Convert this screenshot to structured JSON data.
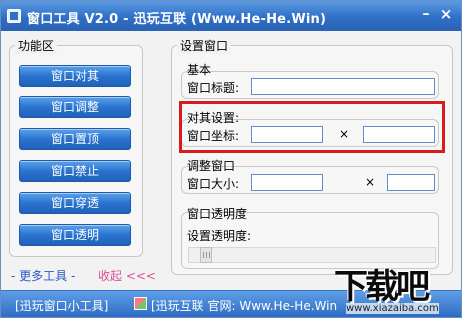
{
  "window": {
    "title": "窗口工具 V2.0 - 迅玩互联 (Www.He-He.Win)",
    "minimize_glyph": "–",
    "close_glyph": "×"
  },
  "left_panel": {
    "label": "功能区",
    "buttons": [
      "窗口对其",
      "窗口调整",
      "窗口置顶",
      "窗口禁止",
      "窗口穿透",
      "窗口透明"
    ],
    "more_link": "- 更多工具 -",
    "collapse_link": "收起 <<<"
  },
  "right_panel": {
    "label": "设置窗口",
    "basic": {
      "label": "基本",
      "title_field_label": "窗口标题:",
      "title_value": ""
    },
    "align": {
      "label": "对其设置:",
      "coord_label": "窗口坐标:",
      "x_value": "",
      "times": "×",
      "y_value": ""
    },
    "resize": {
      "label": "调整窗口",
      "size_label": "窗口大小:",
      "w_value": "",
      "times": "×",
      "h_value": ""
    },
    "opacity": {
      "label": "窗口透明度",
      "setting_label": "设置透明度:"
    }
  },
  "statusbar": {
    "left_text": "[迅玩窗口小工具]",
    "right_text": "[迅玩互联 官网: Www.He-He.Win"
  },
  "watermark": {
    "main": "下载吧",
    "sub": "www.xiazaiba.com"
  },
  "colors": {
    "title_bar": "#2f6fc7",
    "button": "#2a73cf",
    "highlight": "#d81b1b",
    "more_link": "#2c55c6",
    "collapse_link": "#d94f9a"
  }
}
